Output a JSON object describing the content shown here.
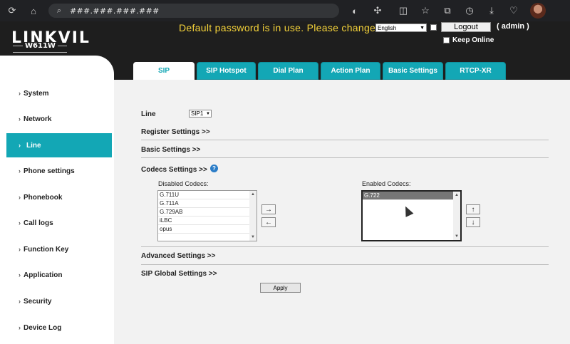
{
  "browser": {
    "url": "###.###.###.###",
    "icons": [
      "refresh-icon",
      "home-icon",
      "search-icon",
      "extension-icon",
      "split-icon",
      "favorites-icon",
      "collections-icon",
      "history-icon",
      "download-icon",
      "performance-icon"
    ]
  },
  "header": {
    "logo": "LINKVIL",
    "model": "W611W",
    "warning": "Default password is in use. Please change",
    "language": "English",
    "logout_label": "Logout",
    "user": "( admin )",
    "keep_online": "Keep Online"
  },
  "tabs": [
    {
      "label": "SIP",
      "active": true
    },
    {
      "label": "SIP Hotspot"
    },
    {
      "label": "Dial Plan"
    },
    {
      "label": "Action Plan"
    },
    {
      "label": "Basic Settings"
    },
    {
      "label": "RTCP-XR"
    }
  ],
  "sidebar": {
    "items": [
      {
        "label": "System"
      },
      {
        "label": "Network"
      },
      {
        "label": "Line",
        "active": true
      },
      {
        "label": "Phone settings"
      },
      {
        "label": "Phonebook"
      },
      {
        "label": "Call logs"
      },
      {
        "label": "Function Key"
      },
      {
        "label": "Application"
      },
      {
        "label": "Security"
      },
      {
        "label": "Device Log"
      }
    ]
  },
  "main": {
    "line_label": "Line",
    "line_value": "SIP1",
    "register_settings": "Register Settings >>",
    "basic_settings": "Basic Settings >>",
    "codecs_settings": "Codecs Settings >>",
    "disabled_codecs_title": "Disabled Codecs:",
    "enabled_codecs_title": "Enabled Codecs:",
    "disabled_codecs": [
      "G.711U",
      "G.711A",
      "G.729AB",
      "iLBC",
      "opus"
    ],
    "enabled_codecs": [
      "G.722"
    ],
    "move_right": "→",
    "move_left": "←",
    "move_up": "↑",
    "move_down": "↓",
    "advanced_settings": "Advanced Settings >>",
    "sip_global_settings": "SIP Global Settings >>",
    "apply_label": "Apply"
  },
  "colors": {
    "accent": "#13a7b5",
    "warning": "#f5d33a",
    "header_bg": "#1e1e1e"
  }
}
